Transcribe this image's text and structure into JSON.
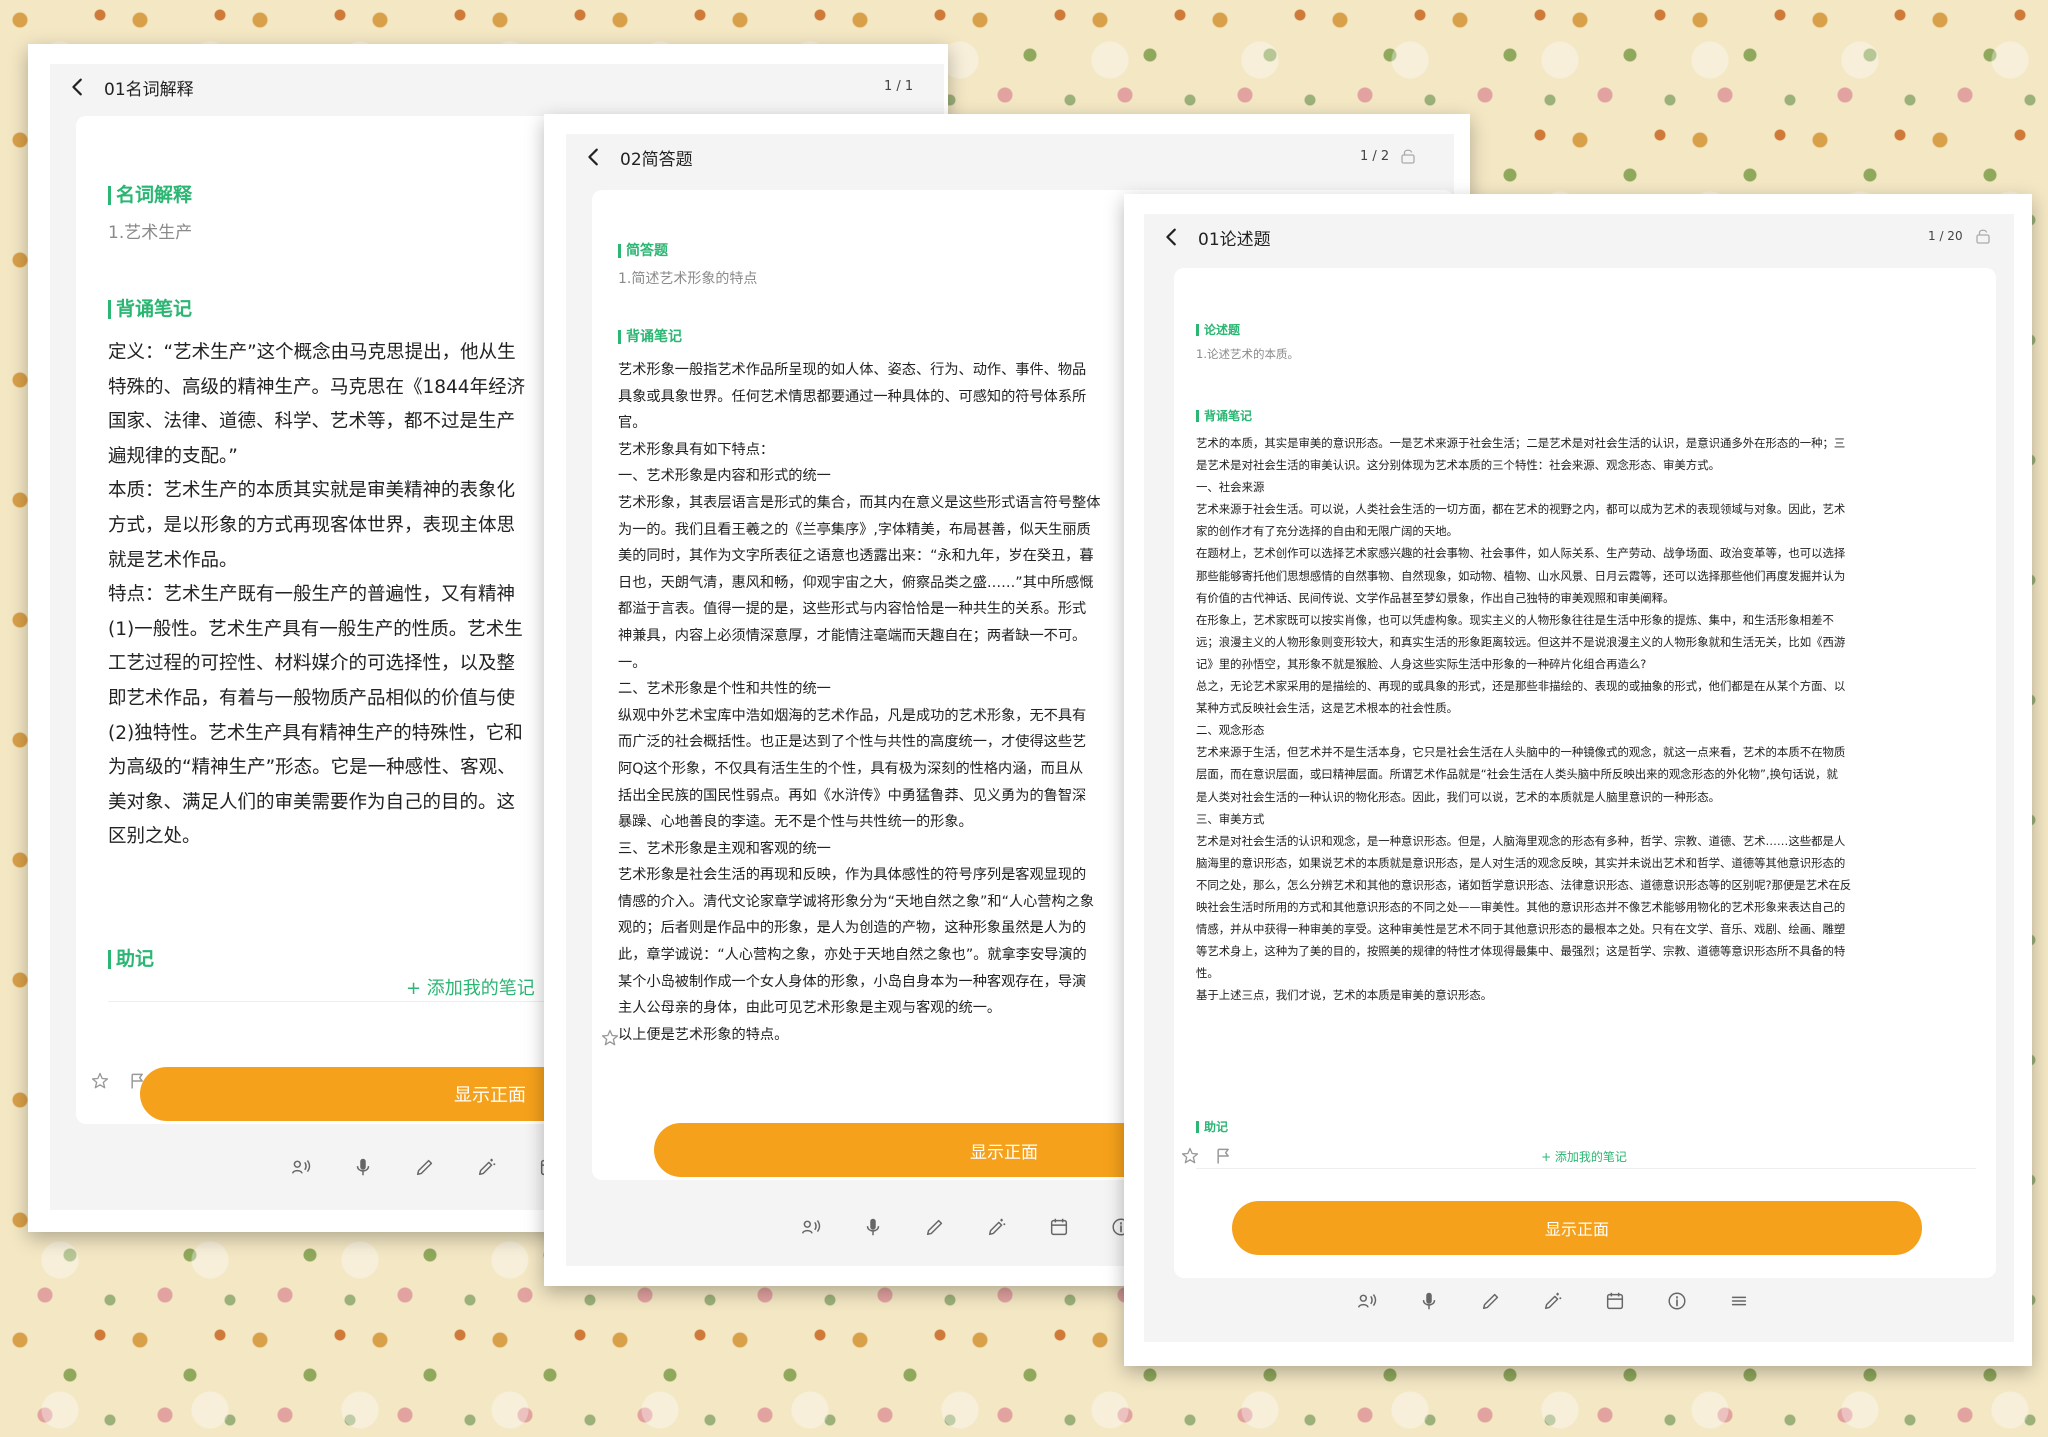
{
  "panels": [
    {
      "title": "01名词解释",
      "counter": "1 / 1",
      "section1": {
        "title": "名词解释",
        "subtitle": "1.艺术生产"
      },
      "section2": {
        "title": "背诵笔记",
        "lines": [
          "定义：“艺术生产”这个概念由马克思提出，他从生",
          "特殊的、高级的精神生产。马克思在《1844年经济",
          "国家、法律、道德、科学、艺术等，都不过是生产",
          "遍规律的支配。”",
          "本质：艺术生产的本质其实就是审美精神的表象化",
          "方式，是以形象的方式再现客体世界，表现主体思",
          "就是艺术作品。",
          "特点：艺术生产既有一般生产的普遍性，又有精神",
          "(1)一般性。艺术生产具有一般生产的性质。艺术生",
          "工艺过程的可控性、材料媒介的可选择性，以及整",
          "即艺术作品，有着与一般物质产品相似的价值与使",
          "(2)独特性。艺术生产具有精神生产的特殊性，它和",
          "为高级的“精神生产”形态。它是一种感性、客观、",
          "美对象、满足人们的审美需要作为自己的目的。这",
          "区别之处。"
        ]
      },
      "section3": {
        "title": "助记",
        "add_note": "+ 添加我的笔记"
      },
      "show_button": "显示正面"
    },
    {
      "title": "02简答题",
      "counter": "1 / 2",
      "section1": {
        "title": "简答题",
        "subtitle": "1.简述艺术形象的特点"
      },
      "section2": {
        "title": "背诵笔记",
        "lines": [
          "艺术形象一般指艺术作品所呈现的如人体、姿态、行为、动作、事件、物品",
          "具象或具象世界。任何艺术情思都要通过一种具体的、可感知的符号体系所",
          "官。",
          "艺术形象具有如下特点：",
          "一、艺术形象是内容和形式的统一",
          "艺术形象，其表层语言是形式的集合，而其内在意义是这些形式语言符号整体",
          "为一的。我们且看王羲之的《兰亭集序》,字体精美，布局甚善，似天生丽质",
          "美的同时，其作为文字所表征之语意也透露出来：“永和九年，岁在癸丑，暮",
          "日也，天朗气清，惠风和畅，仰观宇宙之大，俯察品类之盛……”其中所感慨",
          "都溢于言表。值得一提的是，这些形式与内容恰恰是一种共生的关系。形式",
          "神兼具，内容上必须情深意厚，才能情注毫端而天趣自在；两者缺一不可。",
          "一。",
          "二、艺术形象是个性和共性的统一",
          "纵观中外艺术宝库中浩如烟海的艺术作品，凡是成功的艺术形象，无不具有",
          "而广泛的社会概括性。也正是达到了个性与共性的高度统一，才使得这些艺",
          "阿Q这个形象，不仅具有活生生的个性，具有极为深刻的性格内涵，而且从",
          "括出全民族的国民性弱点。再如《水浒传》中勇猛鲁莽、见义勇为的鲁智深",
          "暴躁、心地善良的李逵。无不是个性与共性统一的形象。",
          "三、艺术形象是主观和客观的统一",
          "艺术形象是社会生活的再现和反映，作为具体感性的符号序列是客观显现的",
          "情感的介入。清代文论家章学诚将形象分为“天地自然之象”和“人心营构之象",
          "观的；后者则是作品中的形象，是人为创造的产物，这种形象虽然是人为的",
          "此，章学诚说：“人心营构之象，亦处于天地自然之象也”。就拿李安导演的",
          "某个小岛被制作成一个女人身体的形象，小岛自身本为一种客观存在，导演",
          "主人公母亲的身体，由此可见艺术形象是主观与客观的统一。",
          "以上便是艺术形象的特点。"
        ]
      },
      "show_button": "显示正面"
    },
    {
      "title": "01论述题",
      "counter": "1 / 20",
      "section1": {
        "title": "论述题",
        "subtitle": "1.论述艺术的本质。"
      },
      "section2": {
        "title": "背诵笔记",
        "lines": [
          "艺术的本质，其实是审美的意识形态。一是艺术来源于社会生活；二是艺术是对社会生活的认识，是意识通多外在形态的一种；三",
          "是艺术是对社会生活的审美认识。这分别体现为艺术本质的三个特性：社会来源、观念形态、审美方式。",
          "一、社会来源",
          "艺术来源于社会生活。可以说，人类社会生活的一切方面，都在艺术的视野之内，都可以成为艺术的表现领域与对象。因此，艺术",
          "家的创作才有了充分选择的自由和无限广阔的天地。",
          "在题材上，艺术创作可以选择艺术家感兴趣的社会事物、社会事件，如人际关系、生产劳动、战争场面、政治变革等，也可以选择",
          "那些能够寄托他们思想感情的自然事物、自然现象，如动物、植物、山水风景、日月云霞等，还可以选择那些他们再度发掘并认为",
          "有价值的古代神话、民间传说、文学作品甚至梦幻景象，作出自己独特的审美观照和审美阐释。",
          "在形象上，艺术家既可以按实肖像，也可以凭虚构象。现实主义的人物形象往往是生活中形象的提炼、集中，和生活形象相差不",
          "远；浪漫主义的人物形象则变形较大，和真实生活的形象距离较远。但这并不是说浪漫主义的人物形象就和生活无关，比如《西游",
          "记》里的孙悟空，其形象不就是猴脸、人身这些实际生活中形象的一种碎片化组合再造么?",
          "总之，无论艺术家采用的是描绘的、再现的或具象的形式，还是那些非描绘的、表现的或抽象的形式，他们都是在从某个方面、以",
          "某种方式反映社会生活，这是艺术根本的社会性质。",
          "二、观念形态",
          "艺术来源于生活，但艺术并不是生活本身，它只是社会生活在人头脑中的一种镜像式的观念，就这一点来看，艺术的本质不在物质",
          "层面，而在意识层面，或曰精神层面。所谓艺术作品就是“社会生活在人类头脑中所反映出来的观念形态的外化物”,换句话说，就",
          "是人类对社会生活的一种认识的物化形态。因此，我们可以说，艺术的本质就是人脑里意识的一种形态。",
          "三、审美方式",
          "艺术是对社会生活的认识和观念，是一种意识形态。但是，人脑海里观念的形态有多种，哲学、宗教、道德、艺术……这些都是人",
          "脑海里的意识形态，如果说艺术的本质就是意识形态，是人对生活的观念反映，其实并未说出艺术和哲学、道德等其他意识形态的",
          "不同之处，那么，怎么分辨艺术和其他的意识形态，诸如哲学意识形态、法律意识形态、道德意识形态等的区别呢?那便是艺术在反",
          "映社会生活时所用的方式和其他意识形态的不同之处——审美性。其他的意识形态并不像艺术能够用物化的艺术形象来表达自己的",
          "情感，并从中获得一种审美的享受。这种审美性是艺术不同于其他意识形态的最根本之处。只有在文学、音乐、戏剧、绘画、雕塑",
          "等艺术身上，这种为了美的目的，按照美的规律的特性才体现得最集中、最强烈；这是哲学、宗教、道德等意识形态所不具备的特",
          "性。",
          "基于上述三点，我们才说，艺术的本质是审美的意识形态。"
        ]
      },
      "section3": {
        "title": "助记",
        "add_note": "+ 添加我的笔记"
      },
      "show_button": "显示正面"
    }
  ],
  "icons": {
    "back": "chevron-left-icon",
    "lock": "lock-icon",
    "star": "star-icon",
    "flag": "flag-icon",
    "toolbar": [
      "read-aloud-icon",
      "microphone-icon",
      "pencil-icon",
      "magic-pen-icon",
      "calendar-icon",
      "info-icon",
      "menu-icon"
    ]
  },
  "colors": {
    "accent": "#f5a11b",
    "green": "#2bb673"
  }
}
